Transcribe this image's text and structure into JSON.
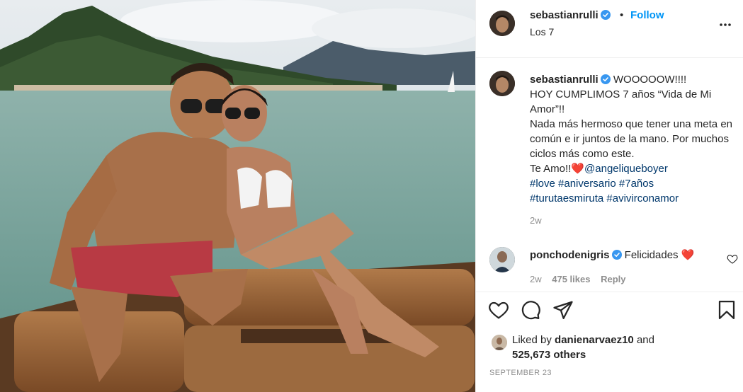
{
  "post": {
    "username": "sebastianrulli",
    "follow_label": "Follow",
    "location": "Los 7",
    "separator": "•"
  },
  "caption": {
    "username": "sebastianrulli",
    "line_1": "WOOOOOW!!!!",
    "line_2": "HOY CUMPLIMOS 7 años “Vida de Mi Amor”!!",
    "line_3": "Nada más hermoso que tener una meta en común e ir juntos de la mano. Por muchos ciclos más como este.",
    "line_4_prefix": "Te Amo!!",
    "heart_emoji": "❤️",
    "mention": "@angeliqueboyer",
    "hashtags_1": "#love #aniversario #7años",
    "hashtags_2": "#turutaesmiruta #avivirconamor",
    "time_ago": "2w"
  },
  "comment": {
    "username": "ponchodenigris",
    "text": "Felicidades",
    "heart_emoji": "❤️",
    "time_ago": "2w",
    "likes": "475 likes",
    "reply_label": "Reply"
  },
  "likes_summary": {
    "prefix": "Liked by",
    "user": "danienarvaez10",
    "connector": "and",
    "others": "525,673 others"
  },
  "date": "SEPTEMBER 23",
  "colors": {
    "accent": "#0095f6",
    "link": "#00376b",
    "muted": "#8e8e8e",
    "text": "#262626"
  },
  "icons": [
    "verified-badge-icon",
    "more-options-icon",
    "heart-icon",
    "comment-icon",
    "share-icon",
    "bookmark-icon"
  ]
}
